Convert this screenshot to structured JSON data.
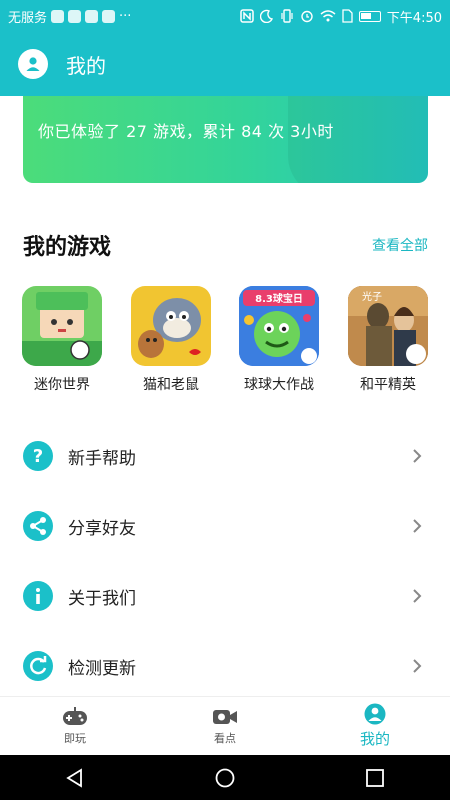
{
  "status_bar": {
    "carrier": "无服务",
    "time": "下午4:50",
    "more": "···"
  },
  "header": {
    "title": "我的",
    "icon": "person-icon"
  },
  "stats": {
    "text": "你已体验了 27 游戏，累计 84 次 3小时"
  },
  "my_games": {
    "title": "我的游戏",
    "view_all": "查看全部",
    "games": [
      {
        "name": "迷你世界",
        "icon": "mini-world-icon",
        "color": "#4dbf5a"
      },
      {
        "name": "猫和老鼠",
        "icon": "tom-and-jerry-icon",
        "color": "#f1c531"
      },
      {
        "name": "球球大作战",
        "icon": "ball-battle-icon",
        "color": "#3b7ee0",
        "banner": "8.3球宝日"
      },
      {
        "name": "和平精英",
        "icon": "peace-elite-icon",
        "color": "#b57a3c",
        "badge": "光子"
      }
    ]
  },
  "menu": [
    {
      "label": "新手帮助",
      "icon": "question-icon"
    },
    {
      "label": "分享好友",
      "icon": "share-icon"
    },
    {
      "label": "关于我们",
      "icon": "info-icon"
    },
    {
      "label": "检测更新",
      "icon": "refresh-icon"
    }
  ],
  "bottom_nav": [
    {
      "label": "即玩",
      "icon": "gamepad-icon",
      "active": false
    },
    {
      "label": "看点",
      "icon": "video-camera-icon",
      "active": false
    },
    {
      "label": "我的",
      "icon": "person-icon",
      "active": true
    }
  ],
  "colors": {
    "accent": "#1bc0c9",
    "card_start": "#4cdc7a",
    "card_end": "#24c8c0"
  }
}
